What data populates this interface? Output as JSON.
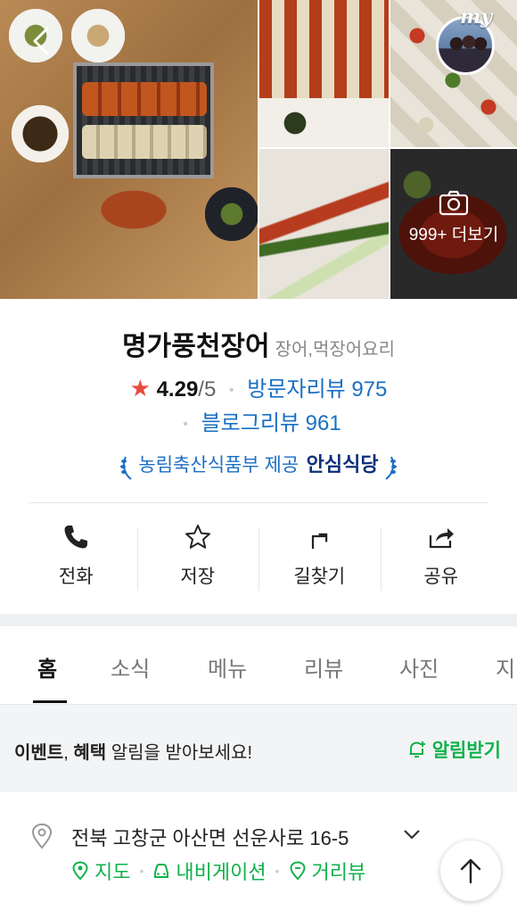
{
  "gallery": {
    "my_label": "my",
    "more_photos": "999+ 더보기"
  },
  "place": {
    "name": "명가풍천장어",
    "category": "장어,먹장어요리",
    "rating": "4.29",
    "rating_max": "/5",
    "visitor_reviews": "방문자리뷰 975",
    "blog_reviews": "블로그리뷰 961",
    "cert_provider": "농림축산식품부 제공",
    "cert_badge": "안심식당"
  },
  "actions": [
    {
      "label": "전화",
      "icon": "phone-icon"
    },
    {
      "label": "저장",
      "icon": "star-outline-icon"
    },
    {
      "label": "길찾기",
      "icon": "directions-arrow-icon"
    },
    {
      "label": "공유",
      "icon": "share-icon"
    }
  ],
  "tabs": [
    "홈",
    "소식",
    "메뉴",
    "리뷰",
    "사진",
    "지"
  ],
  "notice": {
    "bold1": "이벤트",
    "comma": ", ",
    "bold2": "혜택",
    "rest": " 알림을 받아보세요!",
    "button": "알림받기"
  },
  "address": {
    "text": "전북 고창군 아산면 선운사로 16-5",
    "links": [
      "지도",
      "내비게이션",
      "거리뷰"
    ]
  },
  "colors": {
    "accent_green": "#0fb24a",
    "link_blue": "#1a6fc4",
    "star_red": "#e94a3c",
    "badge_navy": "#0d2f7a"
  }
}
